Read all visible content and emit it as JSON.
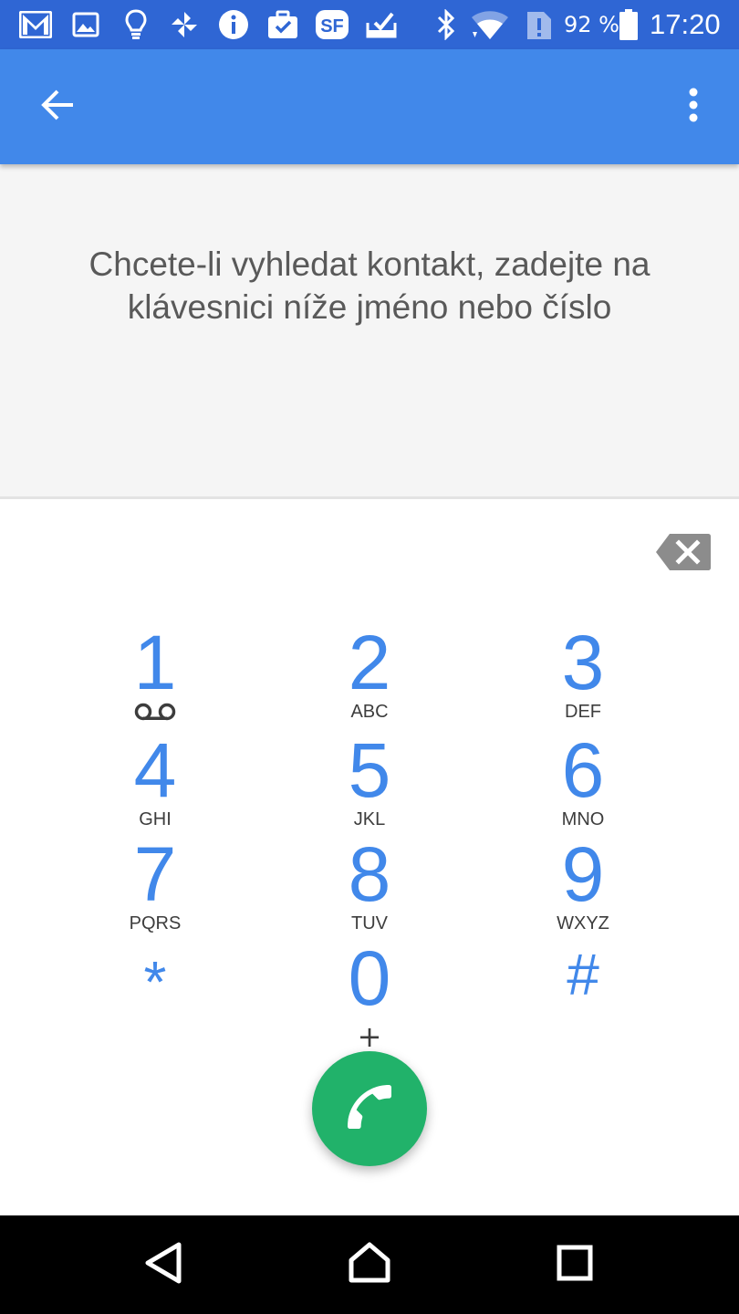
{
  "status_bar": {
    "notification_icons": [
      "gmail-icon",
      "gallery-icon",
      "lightbulb-icon",
      "pinwheel-icon",
      "info-icon",
      "briefcase-check-icon",
      "sf-app-icon",
      "tray-check-icon"
    ],
    "system_icons": [
      "bluetooth-icon",
      "wifi-icon",
      "sim-alert-icon",
      "battery-icon"
    ],
    "battery_percent": "92 %",
    "time": "17:20"
  },
  "app_bar": {
    "back_icon": "arrow-back-icon",
    "overflow_icon": "more-vert-icon",
    "color": "#4188ea"
  },
  "search": {
    "hint": "Chcete-li vyhledat kontakt, zadejte na klávesnici níže jméno nebo číslo"
  },
  "dialpad": {
    "backspace_icon": "backspace-icon",
    "keys": [
      {
        "digit": "1",
        "letters": "",
        "extra_icon": "voicemail-icon"
      },
      {
        "digit": "2",
        "letters": "ABC"
      },
      {
        "digit": "3",
        "letters": "DEF"
      },
      {
        "digit": "4",
        "letters": "GHI"
      },
      {
        "digit": "5",
        "letters": "JKL"
      },
      {
        "digit": "6",
        "letters": "MNO"
      },
      {
        "digit": "7",
        "letters": "PQRS"
      },
      {
        "digit": "8",
        "letters": "TUV"
      },
      {
        "digit": "9",
        "letters": "WXYZ"
      },
      {
        "digit": "*",
        "letters": ""
      },
      {
        "digit": "0",
        "letters": "+"
      },
      {
        "digit": "#",
        "letters": ""
      }
    ],
    "digit_color": "#4188ea",
    "call_button": {
      "icon": "phone-icon",
      "color": "#21b26a"
    }
  },
  "nav_bar": {
    "icons": [
      "back-triangle-icon",
      "home-icon",
      "recents-icon"
    ]
  }
}
